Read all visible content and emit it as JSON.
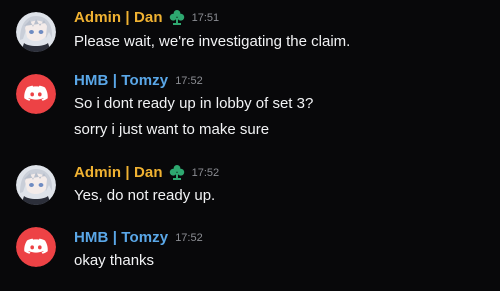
{
  "colors": {
    "admin_name": "#f0b232",
    "hmb_name": "#5aa7e8",
    "discord_red": "#ed4245",
    "role_icon_green": "#2ea870",
    "timestamp": "#8b8d93",
    "text": "#f2f3f5",
    "background": "#08080a"
  },
  "messages": [
    {
      "username": "Admin | Dan",
      "role_icon": "clover-role-icon",
      "avatar": "anime-avatar",
      "timestamp": "17:51",
      "lines": [
        "Please wait, we're investigating the claim."
      ]
    },
    {
      "username": "HMB | Tomzy",
      "avatar": "discord-default-avatar",
      "timestamp": "17:52",
      "lines": [
        "So i dont ready up in lobby of set 3?",
        "sorry i just want to make sure"
      ]
    },
    {
      "username": "Admin | Dan",
      "role_icon": "clover-role-icon",
      "avatar": "anime-avatar",
      "timestamp": "17:52",
      "lines": [
        "Yes, do not ready up."
      ]
    },
    {
      "username": "HMB | Tomzy",
      "avatar": "discord-default-avatar",
      "timestamp": "17:52",
      "lines": [
        "okay thanks"
      ]
    }
  ]
}
